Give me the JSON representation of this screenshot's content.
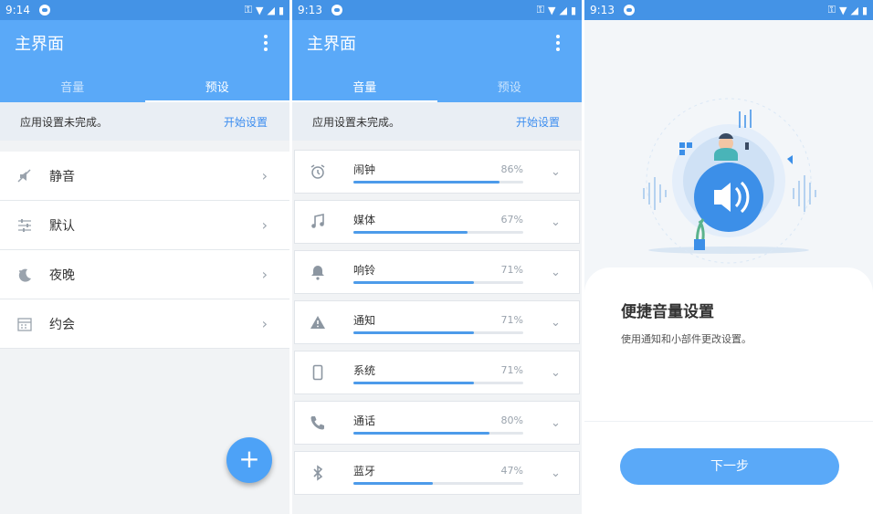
{
  "screen1": {
    "status_time": "9:14",
    "title": "主界面",
    "tabs": [
      "音量",
      "预设"
    ],
    "notice": "应用设置未完成。",
    "notice_link": "开始设置",
    "presets": [
      {
        "icon": "mute-icon",
        "label": "静音"
      },
      {
        "icon": "sliders-icon",
        "label": "默认"
      },
      {
        "icon": "moon-icon",
        "label": "夜晚"
      },
      {
        "icon": "calendar-icon",
        "label": "约会"
      }
    ],
    "fab": "+"
  },
  "screen2": {
    "status_time": "9:13",
    "title": "主界面",
    "tabs": [
      "音量",
      "预设"
    ],
    "notice": "应用设置未完成。",
    "notice_link": "开始设置",
    "volumes": [
      {
        "icon": "alarm-icon",
        "label": "闹钟",
        "value": 86,
        "display": "86%"
      },
      {
        "icon": "music-icon",
        "label": "媒体",
        "value": 67,
        "display": "67%"
      },
      {
        "icon": "bell-icon",
        "label": "响铃",
        "value": 71,
        "display": "71%"
      },
      {
        "icon": "warning-icon",
        "label": "通知",
        "value": 71,
        "display": "71%"
      },
      {
        "icon": "phone-device-icon",
        "label": "系统",
        "value": 71,
        "display": "71%"
      },
      {
        "icon": "call-icon",
        "label": "通话",
        "value": 80,
        "display": "80%"
      },
      {
        "icon": "bluetooth-icon",
        "label": "蓝牙",
        "value": 47,
        "display": "47%"
      }
    ]
  },
  "screen3": {
    "status_time": "9:13",
    "card_title": "便捷音量设置",
    "card_desc": "使用通知和小部件更改设置。",
    "next_button": "下一步"
  },
  "colors": {
    "primary": "#5aa9f8",
    "status": "#4493e6",
    "accent_link": "#3d8ef0"
  }
}
